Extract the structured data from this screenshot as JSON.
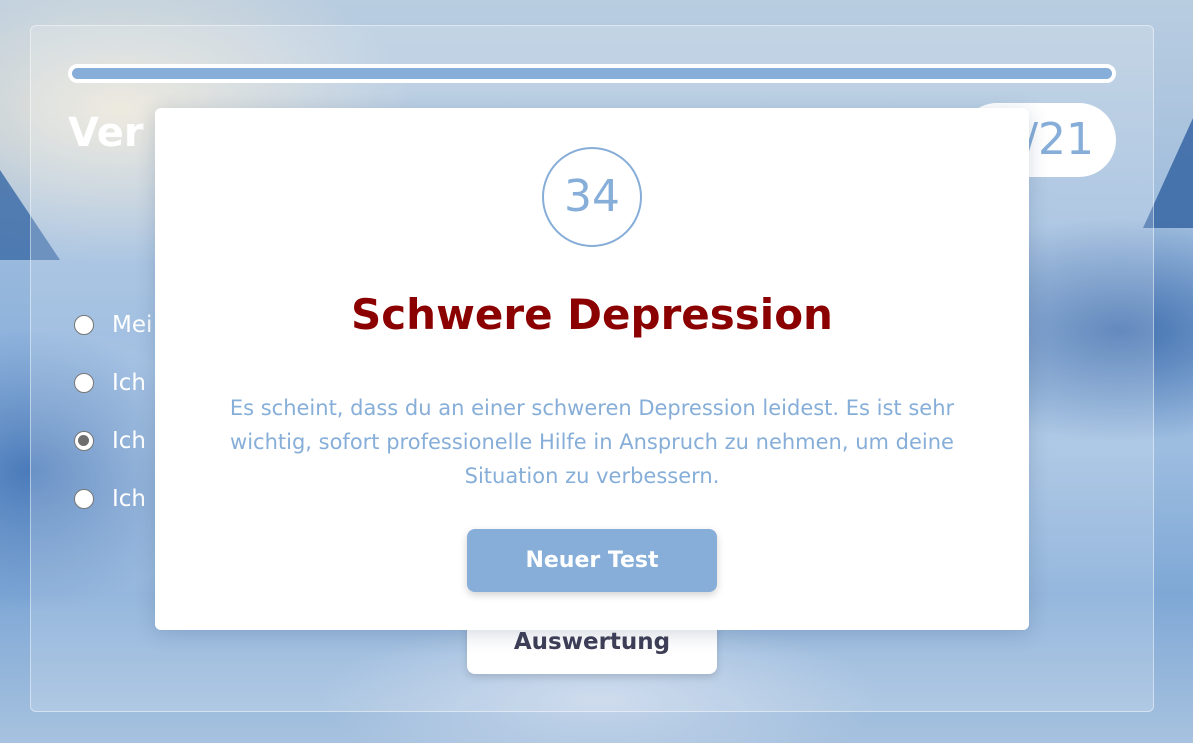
{
  "question": {
    "title_visible": "Ver",
    "counter": "/21"
  },
  "progress": {
    "fraction": 1.0,
    "color": "#86aed8"
  },
  "options": [
    {
      "label": "Mei",
      "checked": false
    },
    {
      "label": "Ich",
      "checked": false
    },
    {
      "label": "Ich",
      "checked": true
    },
    {
      "label": "Ich",
      "checked": false
    }
  ],
  "eval_button_label": "Auswertung",
  "result": {
    "score": "34",
    "title": "Schwere Depression",
    "title_color": "#8b0000",
    "description": "Es scheint, dass du an einer schweren Depression leidest. Es ist sehr wichtig, sofort professionelle Hilfe in Anspruch zu nehmen, um deine Situation zu verbessern.",
    "new_test_label": "Neuer Test"
  }
}
